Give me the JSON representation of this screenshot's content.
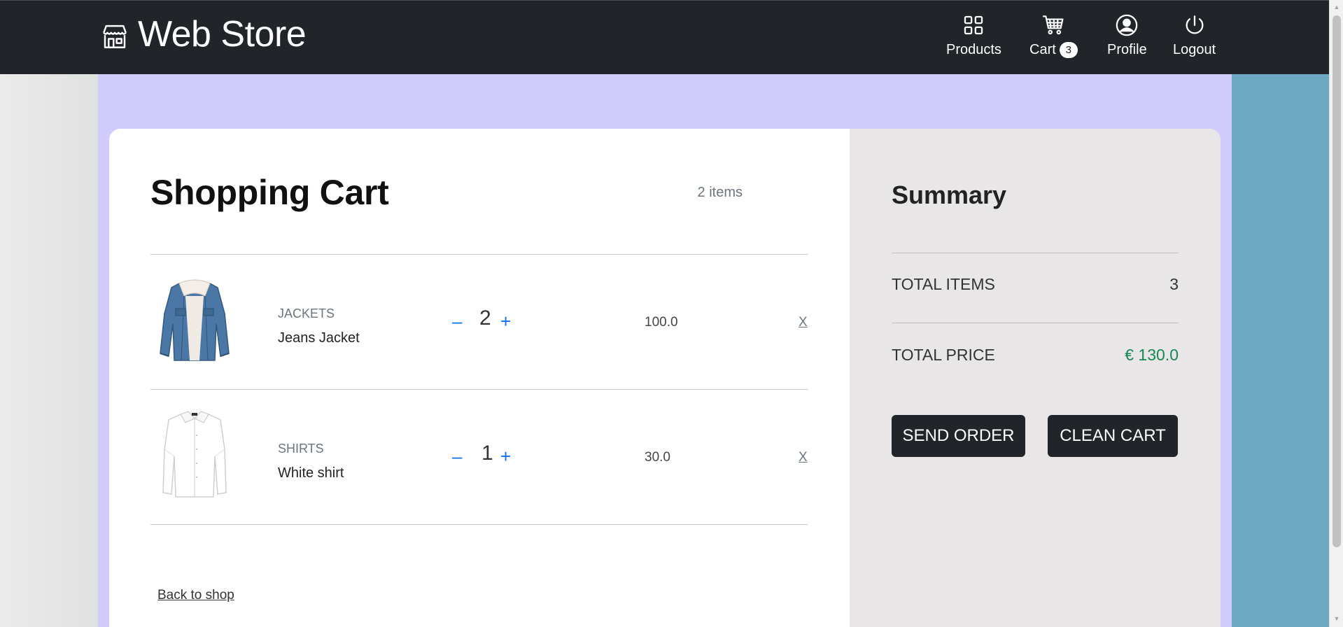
{
  "brand": {
    "name": "Web Store",
    "icon": "storefront-icon"
  },
  "nav": {
    "products": {
      "label": "Products",
      "icon": "grid-icon"
    },
    "cart": {
      "label": "Cart",
      "icon": "cart-icon",
      "badge": "3"
    },
    "profile": {
      "label": "Profile",
      "icon": "user-circle-icon"
    },
    "logout": {
      "label": "Logout",
      "icon": "power-icon"
    }
  },
  "cart": {
    "title": "Shopping Cart",
    "count_label": "2 items",
    "items": [
      {
        "category": "JACKETS",
        "name": "Jeans Jacket",
        "quantity": "2",
        "price": "100.0",
        "remove_label": "X",
        "minus": "–",
        "plus": "+"
      },
      {
        "category": "SHIRTS",
        "name": "White shirt",
        "quantity": "1",
        "price": "30.0",
        "remove_label": "X",
        "minus": "–",
        "plus": "+"
      }
    ],
    "back_link": "Back to shop"
  },
  "summary": {
    "title": "Summary",
    "total_items_label": "TOTAL ITEMS",
    "total_items_value": "3",
    "total_price_label": "TOTAL PRICE",
    "total_price_value": "€ 130.0",
    "send_order_label": "SEND ORDER",
    "clean_cart_label": "CLEAN CART"
  },
  "colors": {
    "navbar": "#212529",
    "page_bg_mid": "#d1ccfc",
    "page_bg_right": "#6ea9c4",
    "summary_bg": "#e8e6e7",
    "accent_blue": "#0d6efd",
    "price_green": "#198754"
  }
}
